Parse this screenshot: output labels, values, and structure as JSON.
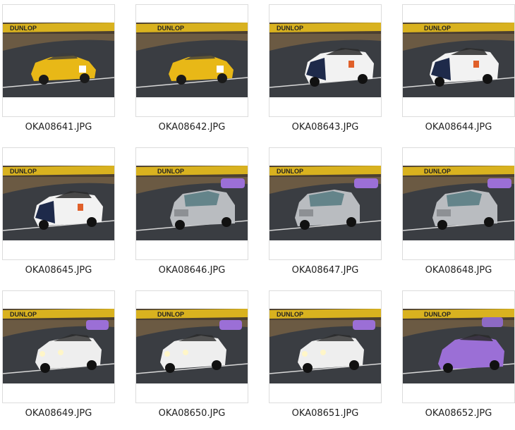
{
  "gallery": {
    "items": [
      {
        "filename": "OKA08641.JPG",
        "car": "yellow-roadster",
        "car_color": "#e8b817",
        "sky": "dunlop"
      },
      {
        "filename": "OKA08642.JPG",
        "car": "yellow-roadster",
        "car_color": "#e8b817",
        "sky": "dunlop"
      },
      {
        "filename": "OKA08643.JPG",
        "car": "white-porsche",
        "car_color": "#f2f2f2",
        "sky": "dunlop"
      },
      {
        "filename": "OKA08644.JPG",
        "car": "white-porsche",
        "car_color": "#f2f2f2",
        "sky": "dunlop"
      },
      {
        "filename": "OKA08645.JPG",
        "car": "white-porsche",
        "car_color": "#f2f2f2",
        "sky": "dunlop"
      },
      {
        "filename": "OKA08646.JPG",
        "car": "silver-march",
        "car_color": "#b9bcc0",
        "sky": "dunlop"
      },
      {
        "filename": "OKA08647.JPG",
        "car": "silver-march",
        "car_color": "#b9bcc0",
        "sky": "dunlop"
      },
      {
        "filename": "OKA08648.JPG",
        "car": "silver-march",
        "car_color": "#b9bcc0",
        "sky": "dunlop"
      },
      {
        "filename": "OKA08649.JPG",
        "car": "white-gt3",
        "car_color": "#eeeeee",
        "sky": "dunlop"
      },
      {
        "filename": "OKA08650.JPG",
        "car": "white-gt3",
        "car_color": "#eeeeee",
        "sky": "dunlop"
      },
      {
        "filename": "OKA08651.JPG",
        "car": "white-gt3",
        "car_color": "#eeeeee",
        "sky": "dunlop"
      },
      {
        "filename": "OKA08652.JPG",
        "car": "purple-911",
        "car_color": "#9b6fd6",
        "sky": "dunlop"
      }
    ],
    "banner_text": "DUNLOP"
  },
  "colors": {
    "asphalt": "#3a3d42",
    "grass": "#6b5a43",
    "banner": "#d9b21f",
    "caption": "#222222"
  }
}
